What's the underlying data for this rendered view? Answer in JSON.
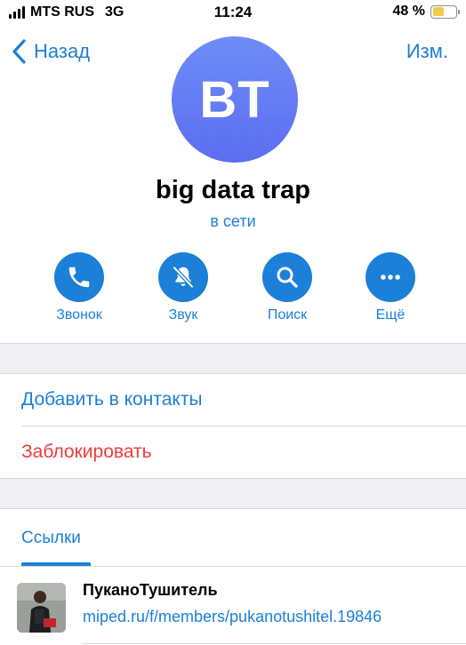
{
  "status_bar": {
    "carrier": "MTS RUS",
    "network": "3G",
    "time": "11:24",
    "battery": "48 %",
    "battery_level": 0.48
  },
  "nav": {
    "back_label": "Назад",
    "edit_label": "Изм."
  },
  "profile": {
    "initials": "BT",
    "name": "big data trap",
    "status": "в сети"
  },
  "actions": [
    {
      "label": "Звонок",
      "icon": "phone-icon"
    },
    {
      "label": "Звук",
      "icon": "bell-muted-icon"
    },
    {
      "label": "Поиск",
      "icon": "search-icon"
    },
    {
      "label": "Ещё",
      "icon": "more-icon"
    }
  ],
  "rows": {
    "add_contact": "Добавить в контакты",
    "block": "Заблокировать"
  },
  "tabs": {
    "links": "Ссылки"
  },
  "links": [
    {
      "title": "ПуканоТушитель",
      "url": "miped.ru/f/members/pukanotushitel.19846"
    }
  ],
  "colors": {
    "accent": "#1c7fd8",
    "destructive": "#ef3b3b",
    "avatar": "#5b6ef0",
    "separator_bg": "#efeff4"
  }
}
